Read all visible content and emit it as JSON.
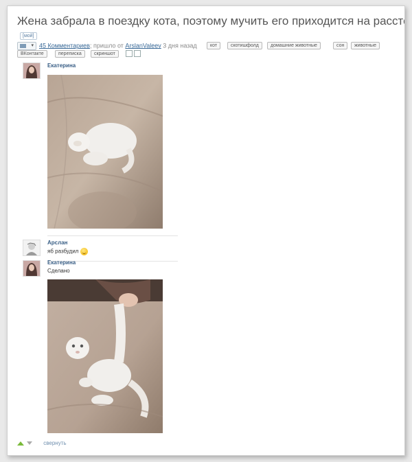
{
  "post": {
    "title": "Жена забрала в поездку кота, поэтому мучить его приходится на расстоянии)))",
    "badge": "[мой]",
    "comments_link": "45 Комментариев",
    "sent_from": "; пришло от ",
    "author_link": "ArslanValeev",
    "time_ago": " 3 дня назад"
  },
  "tags": [
    "кот",
    "скотишфолд",
    "домашние животные",
    "сон",
    "животные",
    "ВКонтакте",
    "переписка",
    "скриншот"
  ],
  "chat": [
    {
      "author": "Екатерина",
      "text": ""
    },
    {
      "author": "Арслан",
      "text": "яб разбудил"
    },
    {
      "author": "Екатерина",
      "text": "Сделано"
    }
  ],
  "footer": {
    "collapse": "свернуть"
  },
  "colors": {
    "link": "#3a6a98",
    "author": "#3a5f86",
    "upvote": "#7aba3a"
  }
}
